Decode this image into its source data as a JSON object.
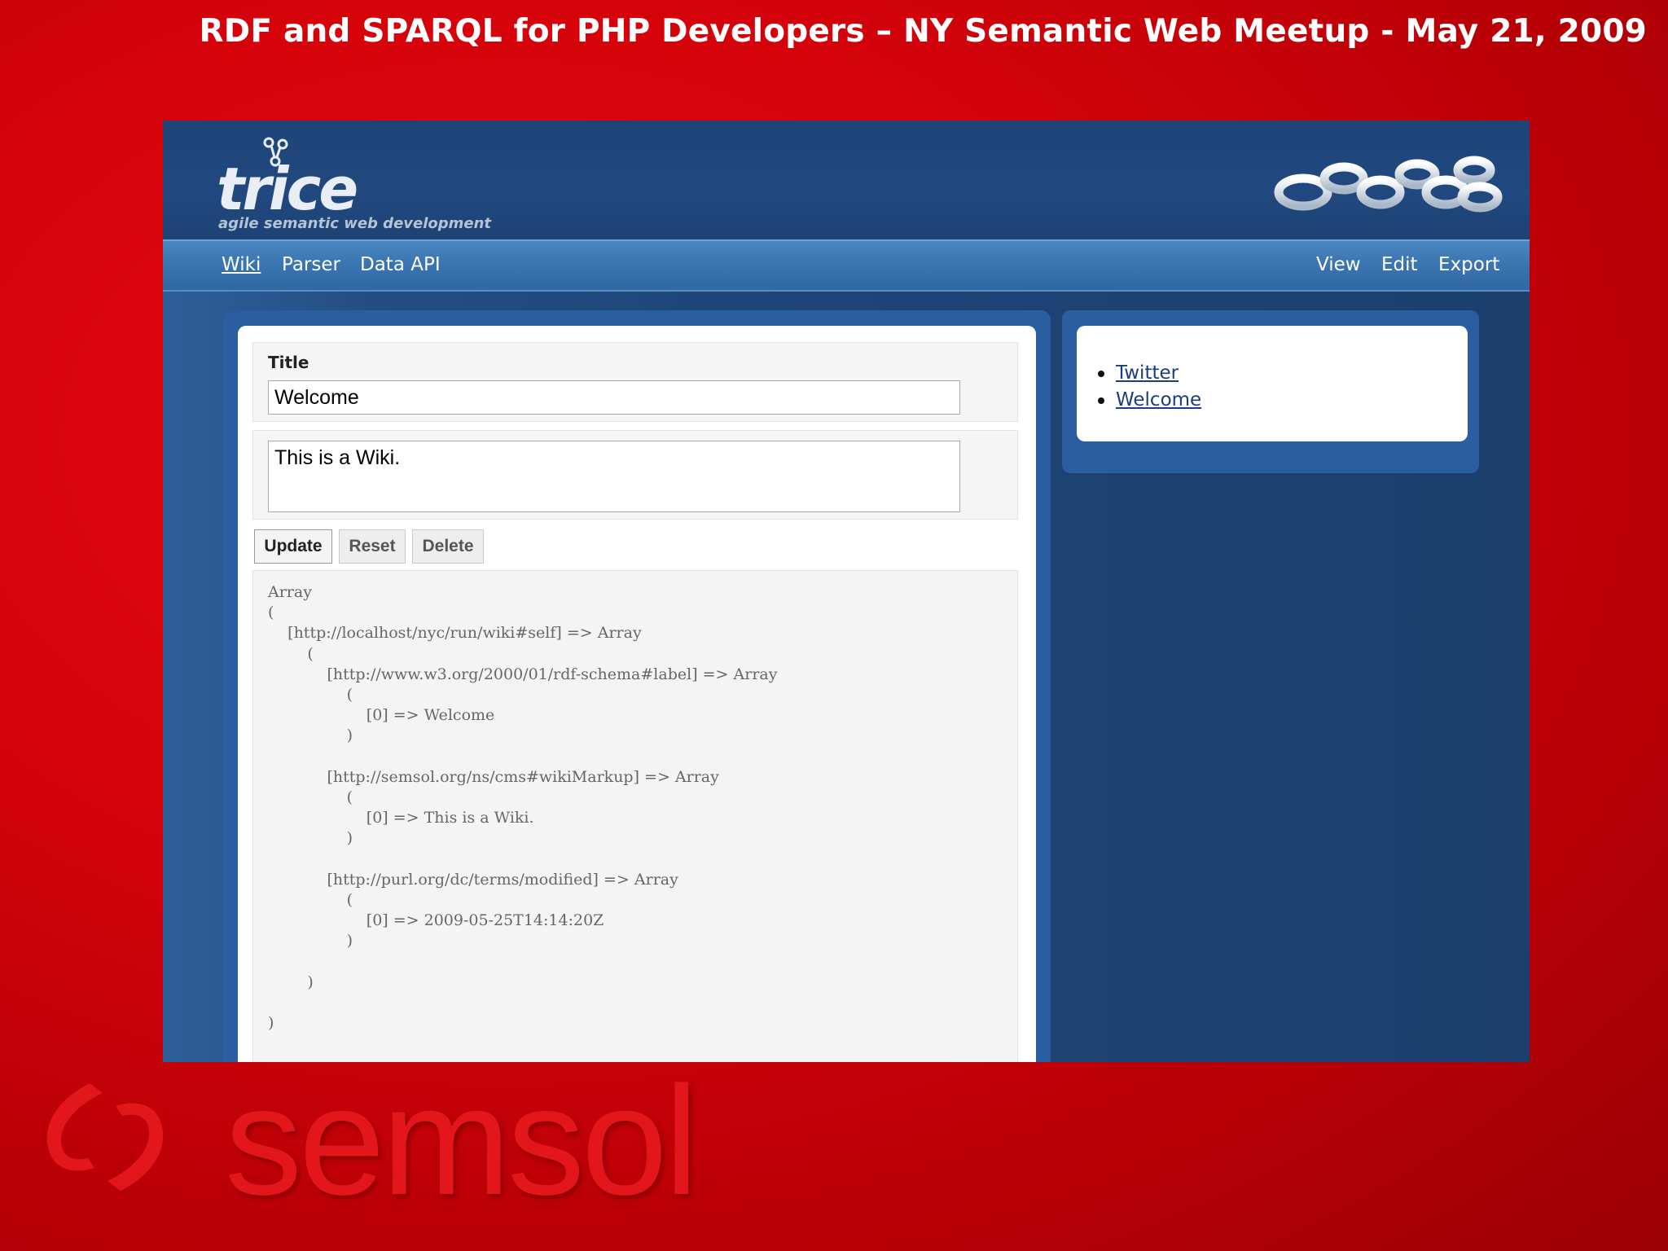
{
  "slide": {
    "title": "RDF and SPARQL for PHP Developers – NY Semantic Web Meetup - May 21, 2009",
    "brand": "semsol"
  },
  "app": {
    "logo_text": "trice",
    "tagline": "agile semantic web development",
    "nav_left": [
      "Wiki",
      "Parser",
      "Data API"
    ],
    "nav_right": [
      "View",
      "Edit",
      "Export"
    ],
    "active_nav": "Wiki"
  },
  "form": {
    "title_label": "Title",
    "title_value": "Welcome",
    "body_value": "This is a Wiki.",
    "buttons": [
      "Update",
      "Reset",
      "Delete"
    ]
  },
  "dump_lines": [
    "Array",
    "(",
    "    [http://localhost/nyc/run/wiki#self] => Array",
    "        (",
    "            [http://www.w3.org/2000/01/rdf-schema#label] => Array",
    "                (",
    "                    [0] => Welcome",
    "                )",
    "",
    "            [http://semsol.org/ns/cms#wikiMarkup] => Array",
    "                (",
    "                    [0] => This is a Wiki.",
    "                )",
    "",
    "            [http://purl.org/dc/terms/modified] => Array",
    "                (",
    "                    [0] => 2009-05-25T14:14:20Z",
    "                )",
    "",
    "        )",
    "",
    ")"
  ],
  "sidebar_links": [
    "Twitter",
    "Welcome"
  ],
  "colors": {
    "slide_bg": "#d4020a",
    "app_bg": "#1e4678",
    "nav_bar": "#3a74b0",
    "link": "#1c3d7a"
  },
  "icons": {
    "trice_logo": "molecule-icon",
    "header_art": "rings-icon",
    "brand_mark": "semsol-swirl-icon"
  }
}
